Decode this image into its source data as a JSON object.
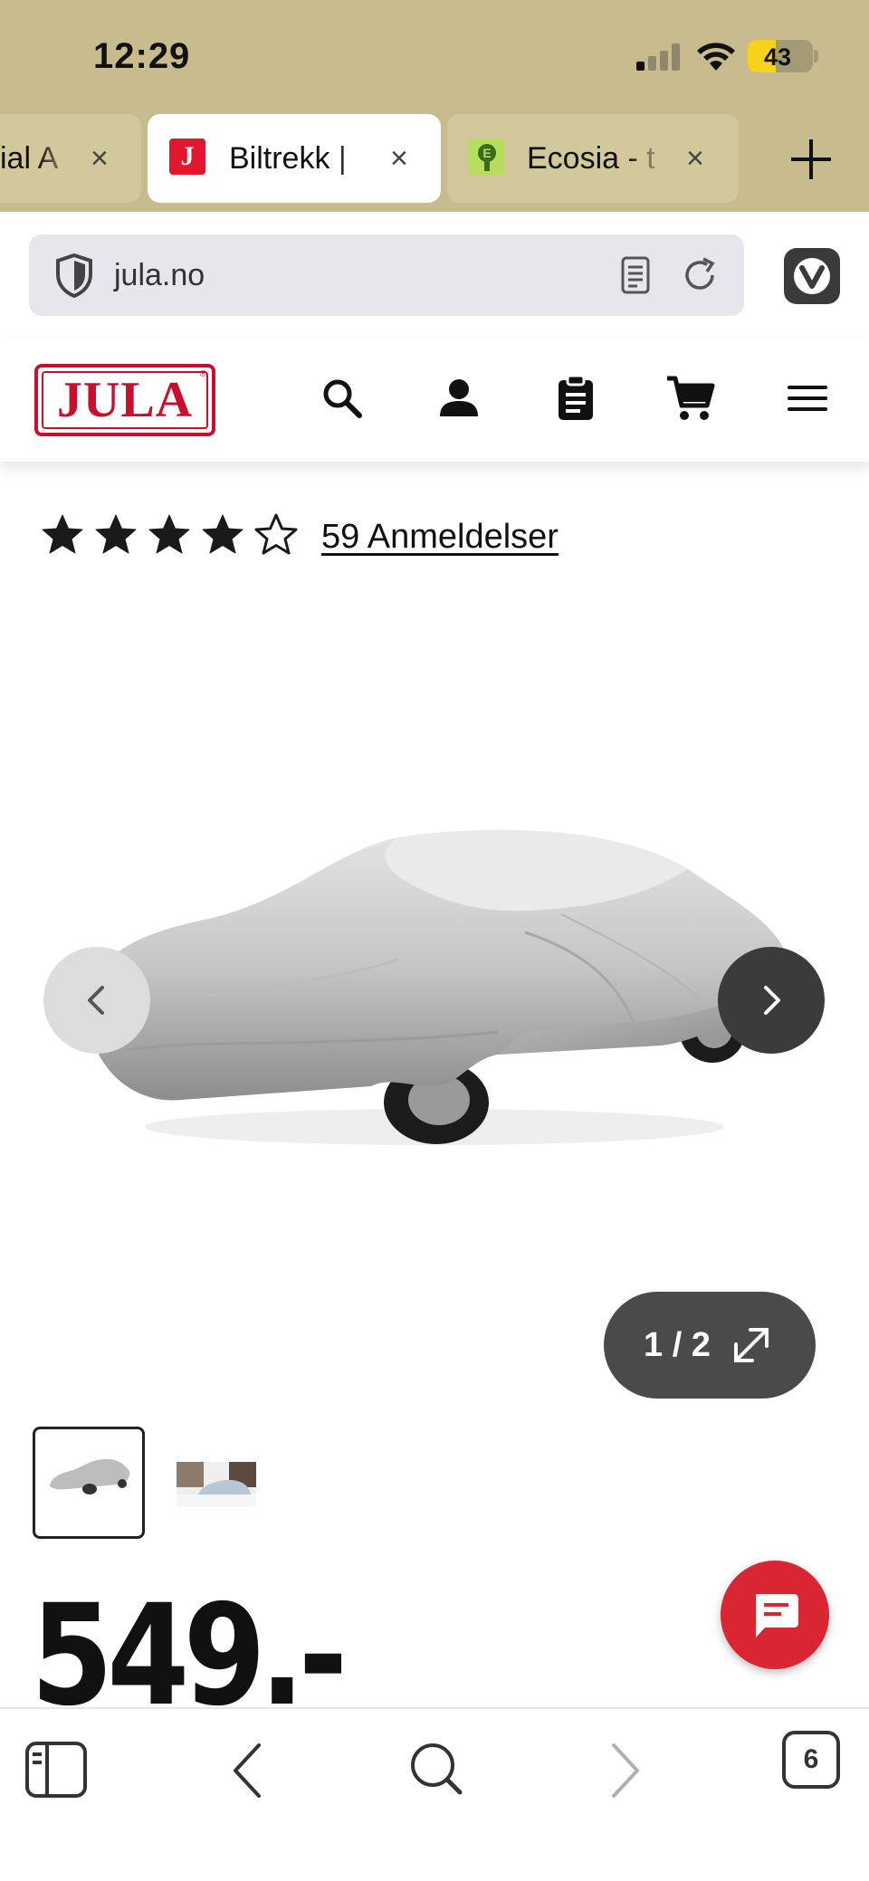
{
  "status": {
    "time": "12:29",
    "battery": "43",
    "battery_level": 0.43,
    "signal_bars_active": 1,
    "signal_bars_total": 4
  },
  "tabs": [
    {
      "label": "ial A",
      "close": "×",
      "favicon": "none"
    },
    {
      "label": "Biltrekk |",
      "close": "×",
      "favicon": "jula-icon",
      "favicon_letter": "J"
    },
    {
      "label": "Ecosia - t",
      "close": "×",
      "favicon": "ecosia-icon"
    }
  ],
  "addressbar": {
    "url": "jula.no"
  },
  "site": {
    "logo": "JULA",
    "header_icons": [
      "search-icon",
      "account-icon",
      "shopping-list-icon",
      "cart-icon",
      "menu-icon"
    ]
  },
  "product": {
    "rating": 4,
    "rating_max": 5,
    "reviews_label": "59 Anmeldelser",
    "image_counter": "1 / 2",
    "price": "549.-"
  },
  "toolbar": {
    "tab_count": "6"
  },
  "colors": {
    "accent": "#c8102e",
    "topbar": "#c8bb8e",
    "chat": "#d92632"
  }
}
